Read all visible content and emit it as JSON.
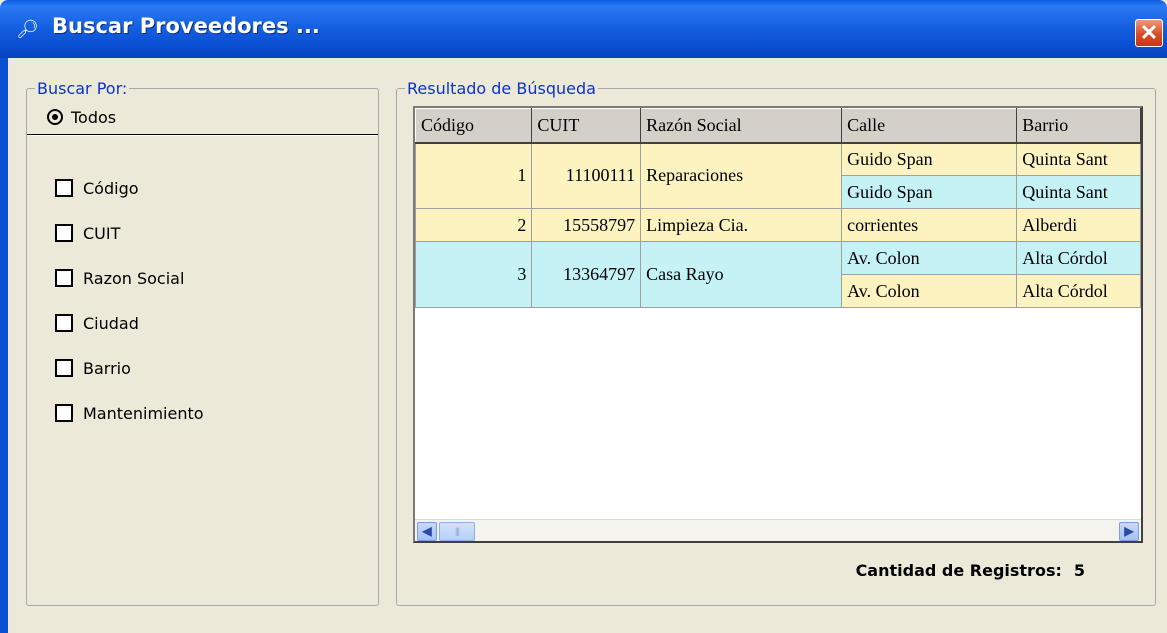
{
  "window": {
    "title": "Buscar Proveedores ...",
    "icon": "magnifier-icon",
    "close_label": "✕"
  },
  "search_by": {
    "legend": "Buscar Por:",
    "radio_all": "Todos",
    "checkboxes": [
      "Código",
      "CUIT",
      "Razon Social",
      "Ciudad",
      "Barrio",
      "Mantenimiento"
    ]
  },
  "results": {
    "legend": "Resultado de Búsqueda",
    "columns": [
      "Código",
      "CUIT",
      "Razón Social",
      "Calle",
      "Barrio"
    ],
    "rows": [
      {
        "codigo": "1",
        "cuit": "11100111",
        "razon": "Reparaciones",
        "calles": [
          "Guido Span",
          "Guido Span"
        ],
        "barrios": [
          "Quinta Sant",
          "Quinta Sant"
        ]
      },
      {
        "codigo": "2",
        "cuit": "15558797",
        "razon": "Limpieza Cia.",
        "calles": [
          "corrientes"
        ],
        "barrios": [
          "Alberdi"
        ]
      },
      {
        "codigo": "3",
        "cuit": "13364797",
        "razon": "Casa Rayo",
        "calles": [
          "Av. Colon",
          "Av. Colon"
        ],
        "barrios": [
          "Alta Córdol",
          "Alta Córdol"
        ]
      }
    ],
    "count_label": "Cantidad de Registros:",
    "count_value": "5"
  },
  "colors": {
    "row_yellow": "#fcf3c1",
    "row_cyan": "#c4f2f5",
    "legend_blue": "#0a34c9"
  }
}
